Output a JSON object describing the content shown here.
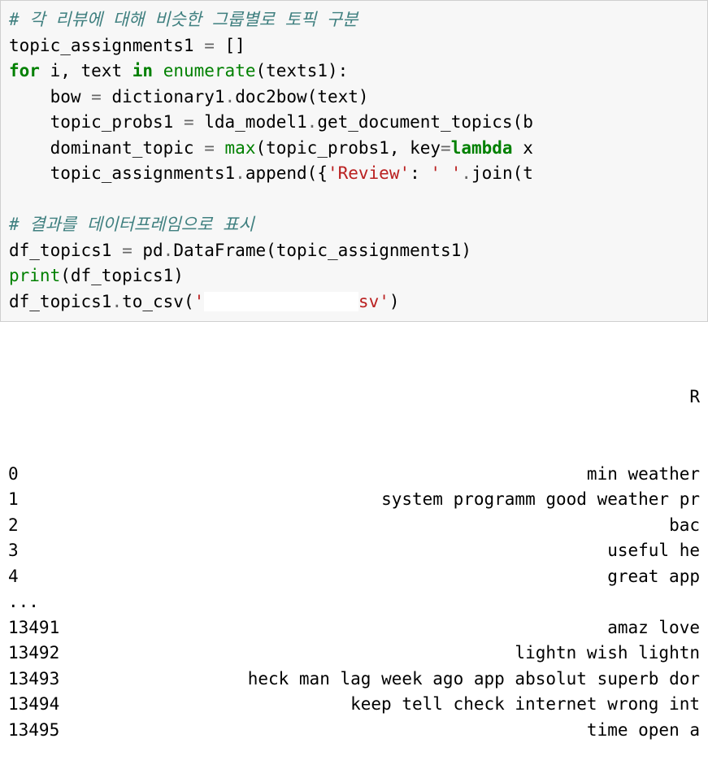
{
  "code": {
    "comment1": "# 각 리뷰에 대해 비슷한 그룹별로 토픽 구분",
    "line2_a": "topic_assignments1 ",
    "line2_op": "=",
    "line2_b": " []",
    "line3_for": "for",
    "line3_a": " i, text ",
    "line3_in": "in",
    "line3_b": " ",
    "line3_enum": "enumerate",
    "line3_c": "(texts1):",
    "line4_a": "    bow ",
    "line4_op": "=",
    "line4_b": " dictionary1",
    "line4_dot": ".",
    "line4_c": "doc2bow(text)",
    "line5_a": "    topic_probs1 ",
    "line5_op": "=",
    "line5_b": " lda_model1",
    "line5_dot": ".",
    "line5_c": "get_document_topics(b",
    "line6_a": "    dominant_topic ",
    "line6_op": "=",
    "line6_b": " ",
    "line6_max": "max",
    "line6_c": "(topic_probs1, key",
    "line6_eq": "=",
    "line6_lambda": "lambda",
    "line6_d": " x",
    "line7_a": "    topic_assignments1",
    "line7_dot": ".",
    "line7_b": "append({",
    "line7_str": "'Review'",
    "line7_c": ": ",
    "line7_str2": "' '",
    "line7_dot2": ".",
    "line7_d": "join(t",
    "blank": "",
    "comment2": "# 결과를 데이터프레임으로 표시",
    "line9_a": "df_topics1 ",
    "line9_op": "=",
    "line9_b": " pd",
    "line9_dot": ".",
    "line9_c": "DataFrame(topic_assignments1)",
    "line10_print": "print",
    "line10_a": "(df_topics1)",
    "line11_a": "df_topics1",
    "line11_dot": ".",
    "line11_b": "to_csv(",
    "line11_str1": "'",
    "line11_gap": "               ",
    "line11_str2": "sv'",
    "line11_c": ")"
  },
  "output": {
    "header_r": "R",
    "rows": [
      {
        "idx": "0",
        "txt": "min weather "
      },
      {
        "idx": "1",
        "txt": "system programm good weather pr"
      },
      {
        "idx": "2",
        "txt": "bac"
      },
      {
        "idx": "3",
        "txt": "useful he"
      },
      {
        "idx": "4",
        "txt": "great app"
      },
      {
        "idx": "...",
        "txt": ""
      },
      {
        "idx": "13491",
        "txt": "amaz love"
      },
      {
        "idx": "13492",
        "txt": "lightn wish lightn "
      },
      {
        "idx": "13493",
        "txt": "heck man lag week ago app absolut superb dor"
      },
      {
        "idx": "13494",
        "txt": "keep tell check internet wrong int"
      },
      {
        "idx": "13495",
        "txt": "time open a"
      }
    ]
  }
}
